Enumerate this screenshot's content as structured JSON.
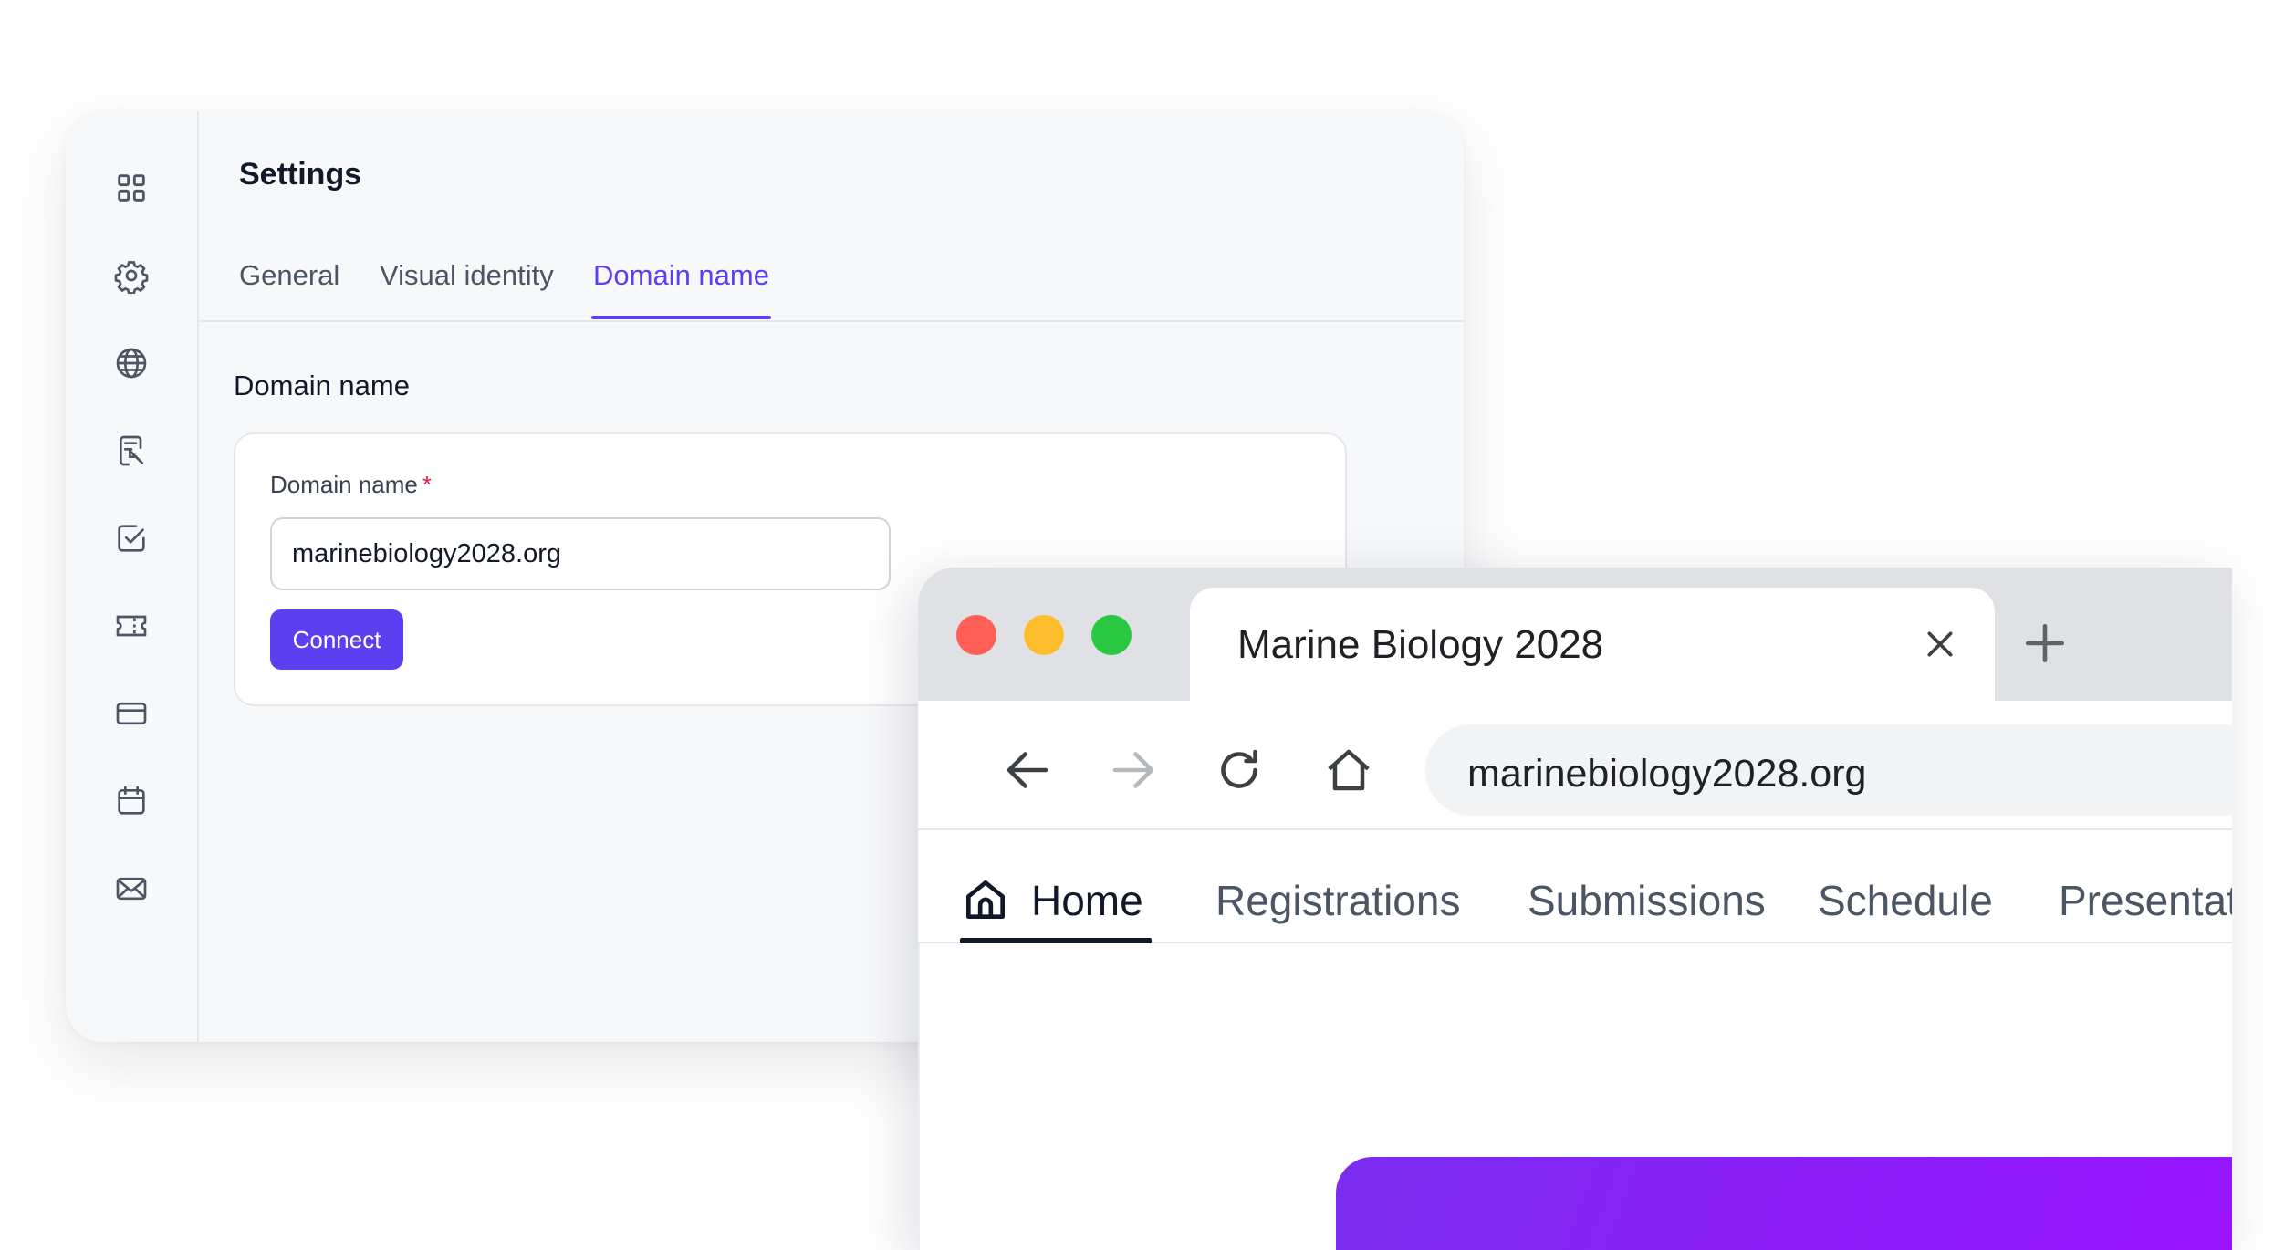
{
  "settings": {
    "title": "Settings",
    "tabs": [
      {
        "label": "General"
      },
      {
        "label": "Visual identity"
      },
      {
        "label": "Domain name",
        "active": true
      }
    ],
    "section_title": "Domain name",
    "form": {
      "field_label": "Domain name",
      "required_mark": "*",
      "value": "marinebiology2028.org",
      "button_label": "Connect"
    },
    "sidebar_icons": [
      "grid-icon",
      "gear-icon",
      "globe-icon",
      "form-edit-icon",
      "checkbox-icon",
      "ticket-icon",
      "credit-card-icon",
      "calendar-icon",
      "mail-icon"
    ]
  },
  "browser": {
    "tab_title": "Marine Biology 2028",
    "url": "marinebiology2028.org",
    "toolbar_icons": [
      "back-arrow-icon",
      "forward-arrow-icon",
      "reload-icon",
      "home-icon"
    ],
    "site_nav": [
      {
        "label": "Home",
        "active": true
      },
      {
        "label": "Registrations"
      },
      {
        "label": "Submissions"
      },
      {
        "label": "Schedule"
      },
      {
        "label": "Presentat"
      }
    ]
  },
  "colors": {
    "accent": "#5b3ff0",
    "hero_gradient_start": "#7b2df0",
    "hero_gradient_end": "#9a14ff",
    "traffic_red": "#ff5f57",
    "traffic_yellow": "#febc2e",
    "traffic_green": "#28c840"
  }
}
